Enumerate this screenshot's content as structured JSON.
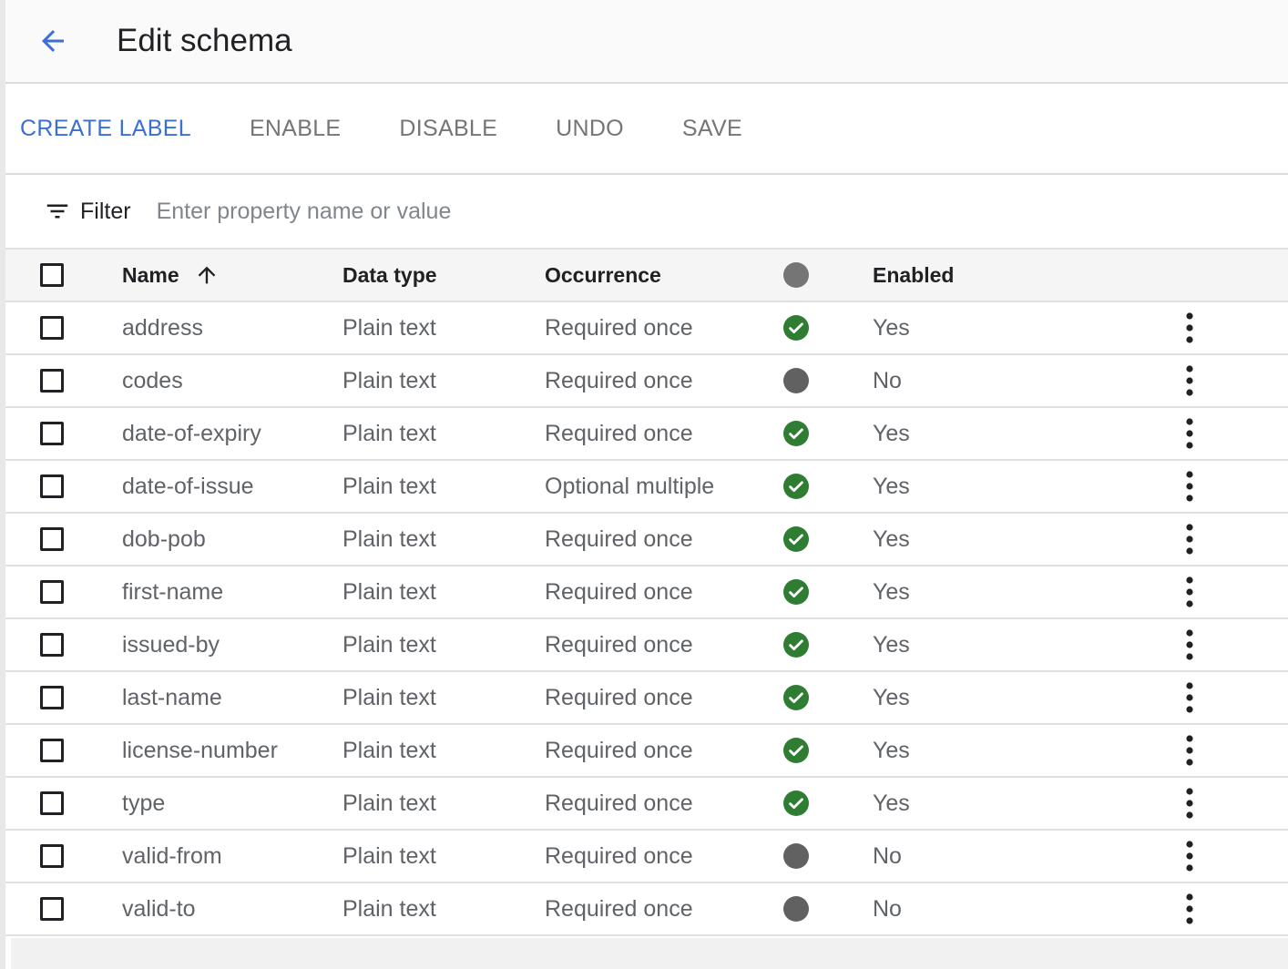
{
  "header": {
    "title": "Edit schema",
    "back_icon": "arrow-left-icon"
  },
  "toolbar": {
    "buttons": [
      "CREATE LABEL",
      "ENABLE",
      "DISABLE",
      "UNDO",
      "SAVE"
    ],
    "accent_color": "#3b6fd4"
  },
  "filter": {
    "label": "Filter",
    "placeholder": "Enter property name or value",
    "value": ""
  },
  "table": {
    "columns": {
      "name": "Name",
      "type": "Data type",
      "occurrence": "Occurrence",
      "enabled": "Enabled"
    },
    "rows": [
      {
        "name": "address",
        "type": "Plain text",
        "occurrence": "Required once",
        "status": "enabled",
        "enabled": "Yes"
      },
      {
        "name": "codes",
        "type": "Plain text",
        "occurrence": "Required once",
        "status": "disabled",
        "enabled": "No"
      },
      {
        "name": "date-of-expiry",
        "type": "Plain text",
        "occurrence": "Required once",
        "status": "enabled",
        "enabled": "Yes"
      },
      {
        "name": "date-of-issue",
        "type": "Plain text",
        "occurrence": "Optional multiple",
        "status": "enabled",
        "enabled": "Yes"
      },
      {
        "name": "dob-pob",
        "type": "Plain text",
        "occurrence": "Required once",
        "status": "enabled",
        "enabled": "Yes"
      },
      {
        "name": "first-name",
        "type": "Plain text",
        "occurrence": "Required once",
        "status": "enabled",
        "enabled": "Yes"
      },
      {
        "name": "issued-by",
        "type": "Plain text",
        "occurrence": "Required once",
        "status": "enabled",
        "enabled": "Yes"
      },
      {
        "name": "last-name",
        "type": "Plain text",
        "occurrence": "Required once",
        "status": "enabled",
        "enabled": "Yes"
      },
      {
        "name": "license-number",
        "type": "Plain text",
        "occurrence": "Required once",
        "status": "enabled",
        "enabled": "Yes"
      },
      {
        "name": "type",
        "type": "Plain text",
        "occurrence": "Required once",
        "status": "enabled",
        "enabled": "Yes"
      },
      {
        "name": "valid-from",
        "type": "Plain text",
        "occurrence": "Required once",
        "status": "disabled",
        "enabled": "No"
      },
      {
        "name": "valid-to",
        "type": "Plain text",
        "occurrence": "Required once",
        "status": "disabled",
        "enabled": "No"
      }
    ],
    "status_colors": {
      "enabled": "#2e7d32",
      "disabled": "#616161"
    }
  }
}
